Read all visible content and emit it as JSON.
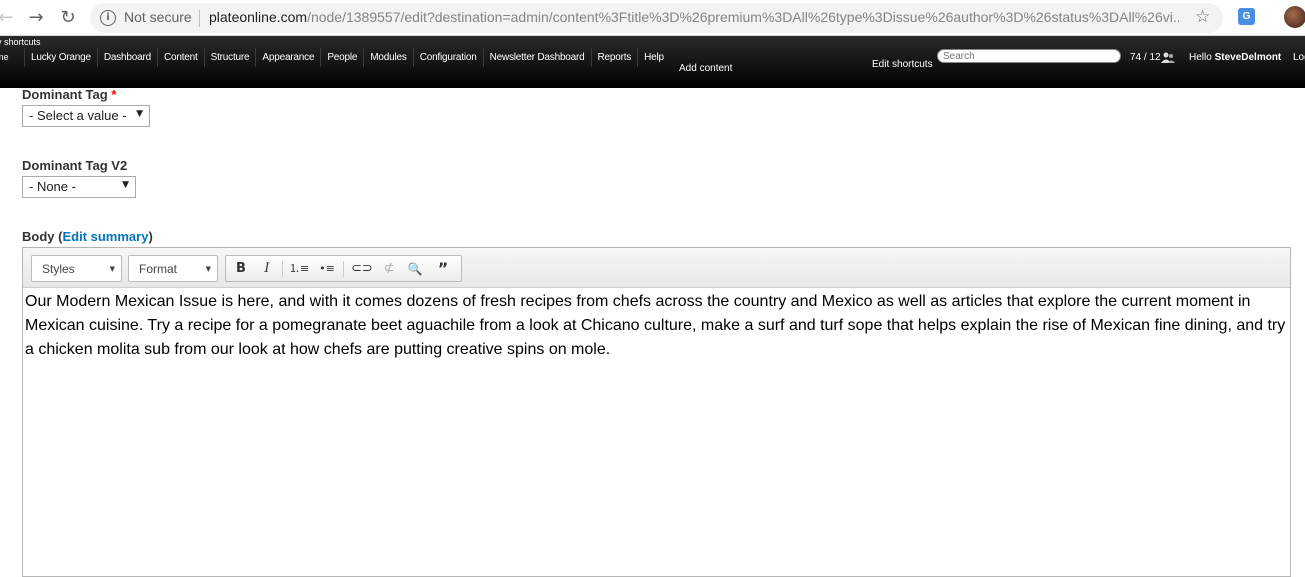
{
  "browser": {
    "security_label": "Not secure",
    "url_host": "plateonline.com",
    "url_path": "/node/1389557/edit?destination=admin/content%3Ftitle%3D%26premium%3DAll%26type%3Dissue%26author%3D%26status%3DAll%26vi..."
  },
  "toolbar": {
    "shortcuts_cut": "v shortcuts",
    "home_cut": "me",
    "menu": [
      "Lucky Orange",
      "Dashboard",
      "Content",
      "Structure",
      "Appearance",
      "People",
      "Modules",
      "Configuration",
      "Newsletter Dashboard",
      "Reports",
      "Help"
    ],
    "add_content": "Add content",
    "edit_shortcuts": "Edit shortcuts",
    "search_placeholder": "Search",
    "user_count": "74 / 12",
    "hello_prefix": "Hello ",
    "username": "SteveDelmont",
    "logout_cut": "Log"
  },
  "form": {
    "dominant_tag": {
      "label": "Dominant Tag",
      "required_mark": "*",
      "value": "- Select a value -"
    },
    "dominant_tag_v2": {
      "label": "Dominant Tag V2",
      "value": "- None -"
    },
    "body": {
      "label_prefix": "Body (",
      "edit_summary": "Edit summary",
      "label_suffix": ")",
      "styles_label": "Styles",
      "format_label": "Format",
      "text": "Our Modern Mexican Issue is here, and with it comes dozens of fresh recipes from chefs across the country and Mexico as well as articles that explore the current moment in Mexican cuisine. Try a recipe for a pomegranate beet aguachile from a look at Chicano culture, make a surf and turf sope that helps explain the rise of Mexican fine dining, and try a chicken molita sub from our look at how chefs are putting creative spins on mole."
    }
  }
}
